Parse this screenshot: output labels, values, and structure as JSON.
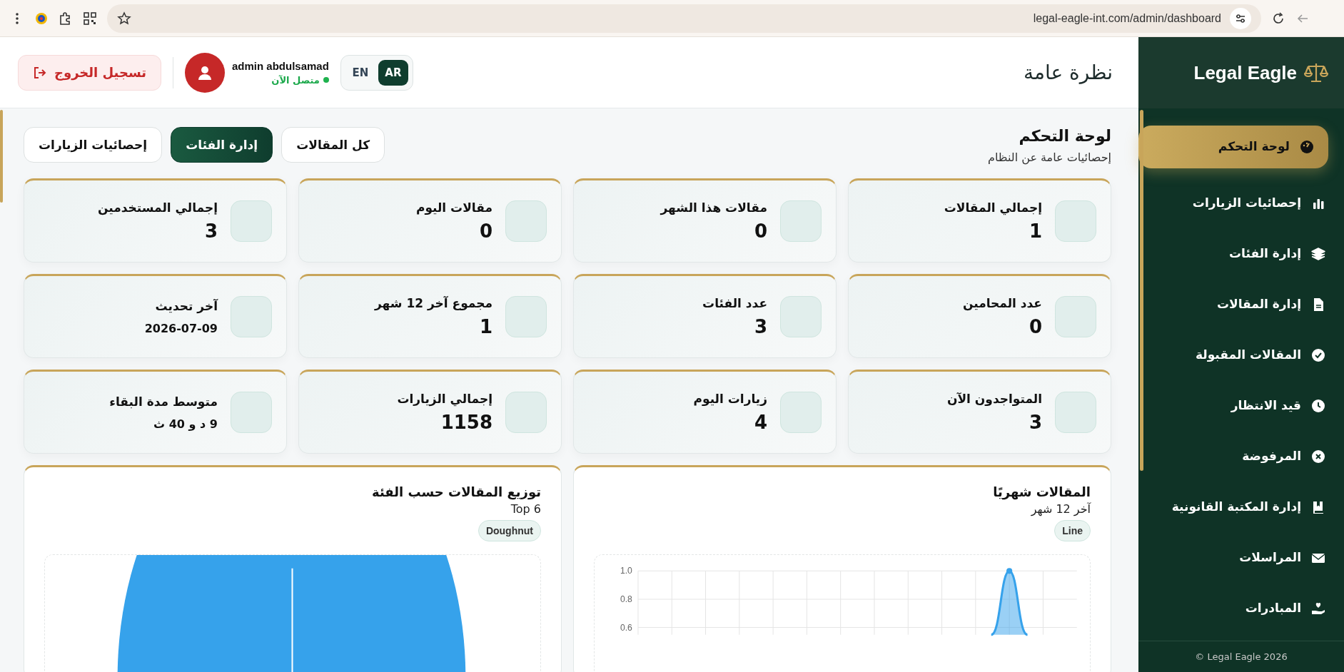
{
  "browser": {
    "url": "legal-eagle-int.com/admin/dashboard"
  },
  "sidebar": {
    "brand": "Legal Eagle",
    "items": [
      {
        "label": "لوحة التحكم",
        "kind": "gauge",
        "selected": true
      },
      {
        "label": "إحصائيات الزيارات",
        "kind": "bars",
        "selected": false
      },
      {
        "label": "إدارة الفئات",
        "kind": "layers",
        "selected": false
      },
      {
        "label": "إدارة المقالات",
        "kind": "file",
        "selected": false
      },
      {
        "label": "المقالات المقبولة",
        "kind": "check",
        "selected": false
      },
      {
        "label": "قيد الانتظار",
        "kind": "clock",
        "selected": false
      },
      {
        "label": "المرفوضة",
        "kind": "cross",
        "selected": false
      },
      {
        "label": "إدارة المكتبة القانونية",
        "kind": "book",
        "selected": false
      },
      {
        "label": "المراسلات",
        "kind": "mail",
        "selected": false
      },
      {
        "label": "المبادرات",
        "kind": "hand",
        "selected": false
      }
    ],
    "footer": "Legal Eagle 2026 ©"
  },
  "header": {
    "title": "نظرة عامة",
    "languages": [
      {
        "label": "AR",
        "selected": true
      },
      {
        "label": "EN",
        "selected": false
      }
    ],
    "user": {
      "name": "admin abdulsamad",
      "status": "متصل الآن",
      "online": true
    },
    "logout": "تسجيل الخروج"
  },
  "page": {
    "title": "لوحة التحكم",
    "subtitle": "إحصائيات عامة عن النظام",
    "actions": [
      {
        "label": "كل المقالات",
        "primary": false
      },
      {
        "label": "إدارة الفئات",
        "primary": true
      },
      {
        "label": "إحصائيات الزيارات",
        "primary": false
      }
    ]
  },
  "stats": [
    {
      "label": "إجمالي المقالات",
      "value": "1"
    },
    {
      "label": "مقالات هذا الشهر",
      "value": "0"
    },
    {
      "label": "مقالات اليوم",
      "value": "0"
    },
    {
      "label": "إجمالي المستخدمين",
      "value": "3"
    },
    {
      "label": "عدد المحامين",
      "value": "0"
    },
    {
      "label": "عدد الفئات",
      "value": "3"
    },
    {
      "label": "مجموع آخر 12 شهر",
      "value": "1"
    },
    {
      "label": "آخر تحديث",
      "value": "2026-07-09",
      "small": true
    },
    {
      "label": "المتواجدون الآن",
      "value": "3"
    },
    {
      "label": "زيارات اليوم",
      "value": "4"
    },
    {
      "label": "إجمالي الزيارات",
      "value": "1158"
    },
    {
      "label": "متوسط مدة البقاء",
      "value": "9 د و 40 ث",
      "small": true
    }
  ],
  "charts": [
    {
      "kind": "line",
      "title": "المقالات شهريًا",
      "subtitle": "آخر 12 شهر",
      "badge": "Line",
      "y_axis_labels": [
        "1.0",
        "0.8",
        "0.6"
      ]
    },
    {
      "kind": "doughnut",
      "title": "توزيع المقالات حسب الفئة",
      "subtitle": "Top 6",
      "badge": "Doughnut"
    }
  ]
}
